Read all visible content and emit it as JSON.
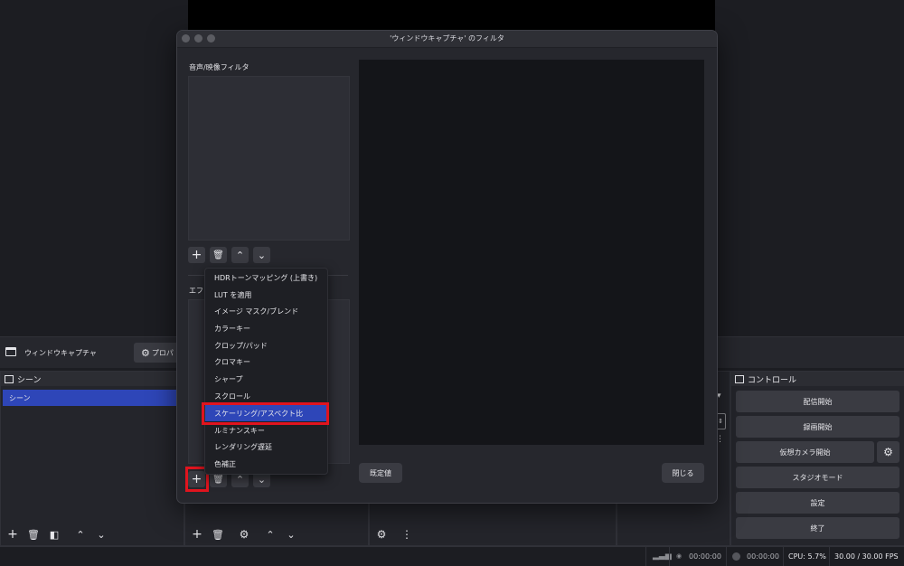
{
  "dialog": {
    "title": "'ウィンドウキャプチャ' のフィルタ",
    "audio_video_label": "音声/映像フィルタ",
    "effect_label_partial": "エフ",
    "defaults_button": "既定値",
    "close_button": "閉じる"
  },
  "context_menu": {
    "items": [
      "HDRトーンマッピング (上書き)",
      "LUT を適用",
      "イメージ マスク/ブレンド",
      "カラーキー",
      "クロップ/パッド",
      "クロマキー",
      "シャープ",
      "スクロール",
      "スケーリング/アスペクト比",
      "ルミナンスキー",
      "レンダリング遅延",
      "色補正"
    ],
    "selected_index": 8
  },
  "source_bar": {
    "source_name": "ウィンドウキャプチャ",
    "properties_partial": "プロパ"
  },
  "scenes": {
    "title": "シーン",
    "items": [
      "シーン"
    ]
  },
  "controls": {
    "title": "コントロール",
    "buttons": [
      "配信開始",
      "録画開始",
      "仮想カメラ開始",
      "スタジオモード",
      "設定",
      "終了"
    ]
  },
  "status": {
    "stream_time": "00:00:00",
    "rec_time": "00:00:00",
    "cpu": "CPU: 5.7%",
    "fps": "30.00 / 30.00 FPS"
  },
  "colors": {
    "accent": "#2e46b8",
    "highlight": "#e0141e"
  }
}
